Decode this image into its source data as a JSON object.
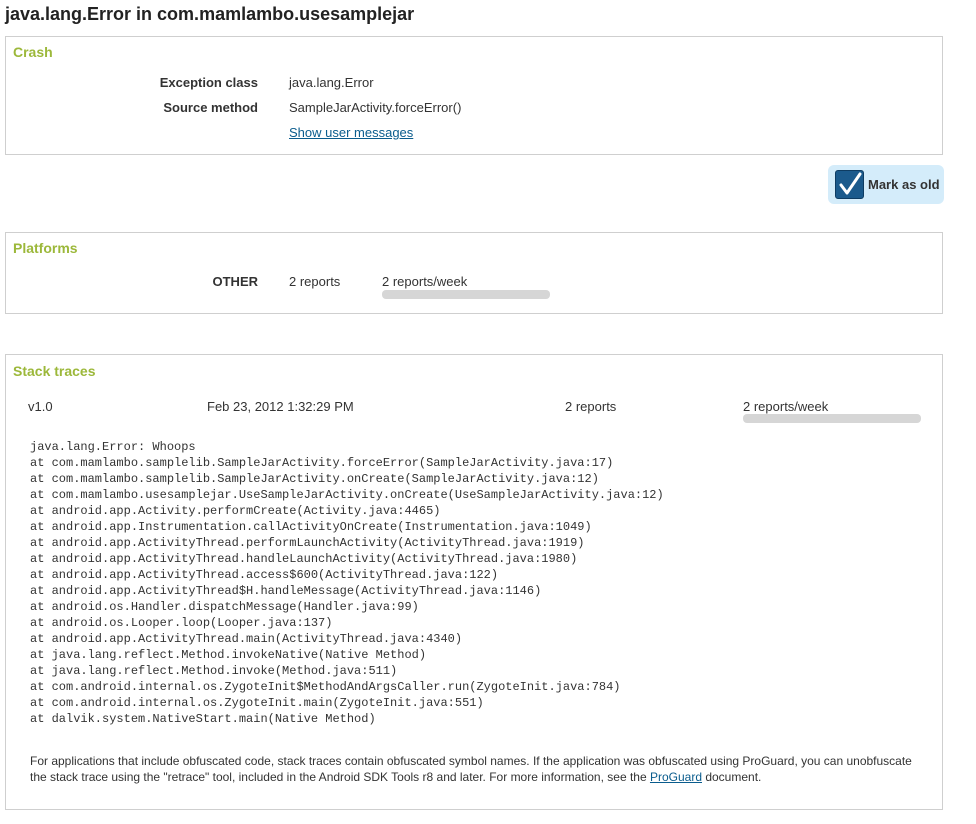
{
  "page": {
    "title": "java.lang.Error in com.mamlambo.usesamplejar"
  },
  "crash": {
    "title": "Crash",
    "exception_class_label": "Exception class",
    "exception_class_value": "java.lang.Error",
    "source_method_label": "Source method",
    "source_method_value": "SampleJarActivity.forceError()",
    "show_messages_link": "Show user messages"
  },
  "mark_old": {
    "label": "Mark as old",
    "icon": "checkmark-icon",
    "color": "#1b5a8c"
  },
  "platforms": {
    "title": "Platforms",
    "rows": [
      {
        "name": "OTHER",
        "reports": "2 reports",
        "rate": "2 reports/week",
        "rate_fill": 1.0
      }
    ]
  },
  "stack_traces": {
    "title": "Stack traces",
    "entry": {
      "version": "v1.0",
      "date": "Feb 23, 2012 1:32:29 PM",
      "reports": "2 reports",
      "rate": "2 reports/week",
      "rate_fill": 1.0
    },
    "lines": [
      "java.lang.Error: Whoops",
      "at com.mamlambo.samplelib.SampleJarActivity.forceError(SampleJarActivity.java:17)",
      "at com.mamlambo.samplelib.SampleJarActivity.onCreate(SampleJarActivity.java:12)",
      "at com.mamlambo.usesamplejar.UseSampleJarActivity.onCreate(UseSampleJarActivity.java:12)",
      "at android.app.Activity.performCreate(Activity.java:4465)",
      "at android.app.Instrumentation.callActivityOnCreate(Instrumentation.java:1049)",
      "at android.app.ActivityThread.performLaunchActivity(ActivityThread.java:1919)",
      "at android.app.ActivityThread.handleLaunchActivity(ActivityThread.java:1980)",
      "at android.app.ActivityThread.access$600(ActivityThread.java:122)",
      "at android.app.ActivityThread$H.handleMessage(ActivityThread.java:1146)",
      "at android.os.Handler.dispatchMessage(Handler.java:99)",
      "at android.os.Looper.loop(Looper.java:137)",
      "at android.app.ActivityThread.main(ActivityThread.java:4340)",
      "at java.lang.reflect.Method.invokeNative(Native Method)",
      "at java.lang.reflect.Method.invoke(Method.java:511)",
      "at com.android.internal.os.ZygoteInit$MethodAndArgsCaller.run(ZygoteInit.java:784)",
      "at com.android.internal.os.ZygoteInit.main(ZygoteInit.java:551)",
      "at dalvik.system.NativeStart.main(Native Method)"
    ],
    "note_text": "For applications that include obfuscated code, stack traces contain obfuscated symbol names. If the application was obfuscated using ProGuard, you can unobfuscate the stack trace using the \"retrace\" tool, included in the Android SDK Tools r8 and later. For more information, see the ",
    "note_link": "ProGuard",
    "note_end": " document."
  }
}
